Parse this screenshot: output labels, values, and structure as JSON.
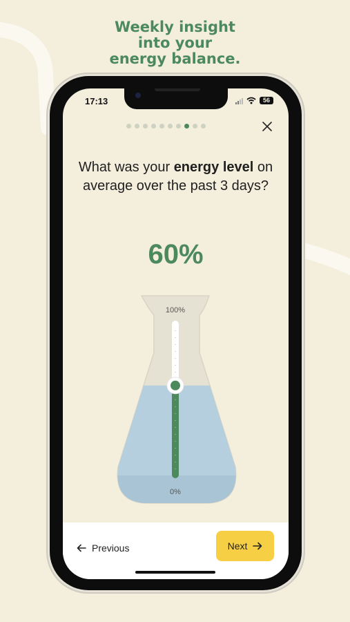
{
  "headline": {
    "line1": "Weekly insight",
    "line2": "into your",
    "line3": "energy balance."
  },
  "status": {
    "time": "17:13",
    "battery": "56"
  },
  "progress": {
    "total_steps": 10,
    "current_step": 8
  },
  "question": {
    "prefix": "What was your ",
    "emphasis": "energy level",
    "suffix": " on average over the past 3 days?"
  },
  "value_display": "60%",
  "slider": {
    "value": 0.6,
    "max_label": "100%",
    "min_label": "0%"
  },
  "nav": {
    "previous_label": "Previous",
    "next_label": "Next"
  },
  "colors": {
    "accent_green": "#4c8a5e",
    "button_yellow": "#f7cf45",
    "water_blue": "#b5cfde",
    "background": "#f4eedd"
  },
  "icons": {
    "close": "close-icon",
    "previous": "arrow-left-icon",
    "next": "arrow-right-icon"
  }
}
